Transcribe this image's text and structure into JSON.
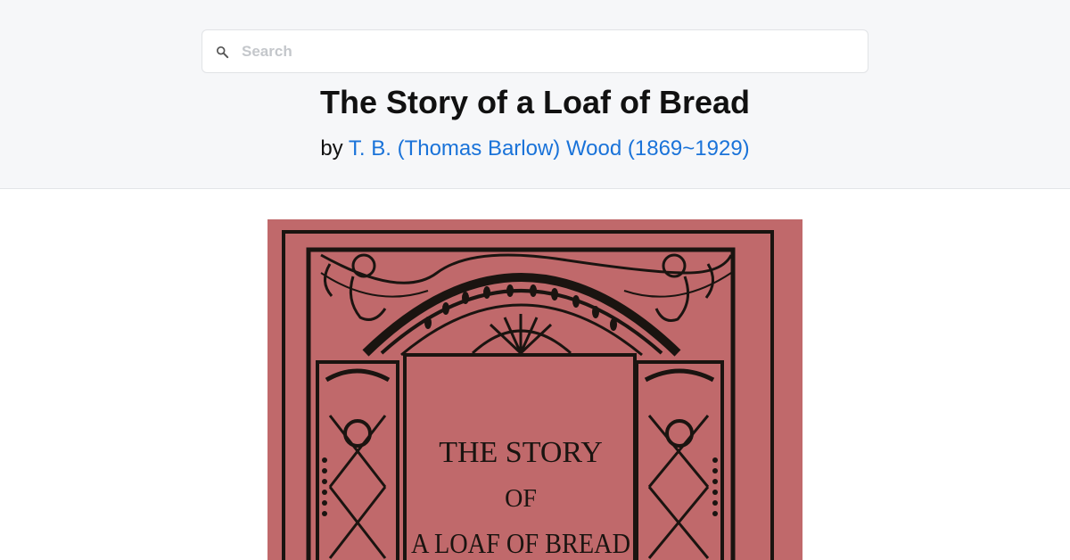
{
  "search": {
    "placeholder": "Search"
  },
  "book": {
    "title": "The Story of a Loaf of Bread",
    "by_prefix": "by",
    "author": "T. B. (Thomas Barlow) Wood (1869~1929)"
  },
  "cover": {
    "line1": "THE STORY",
    "line2": "OF",
    "line3": "A LOAF OF BREAD",
    "background": "#c0696b",
    "ink": "#1a1410"
  },
  "colors": {
    "link": "#1a73d9",
    "header_bg": "#f6f7f9"
  },
  "icons": {
    "search": "search-icon"
  }
}
